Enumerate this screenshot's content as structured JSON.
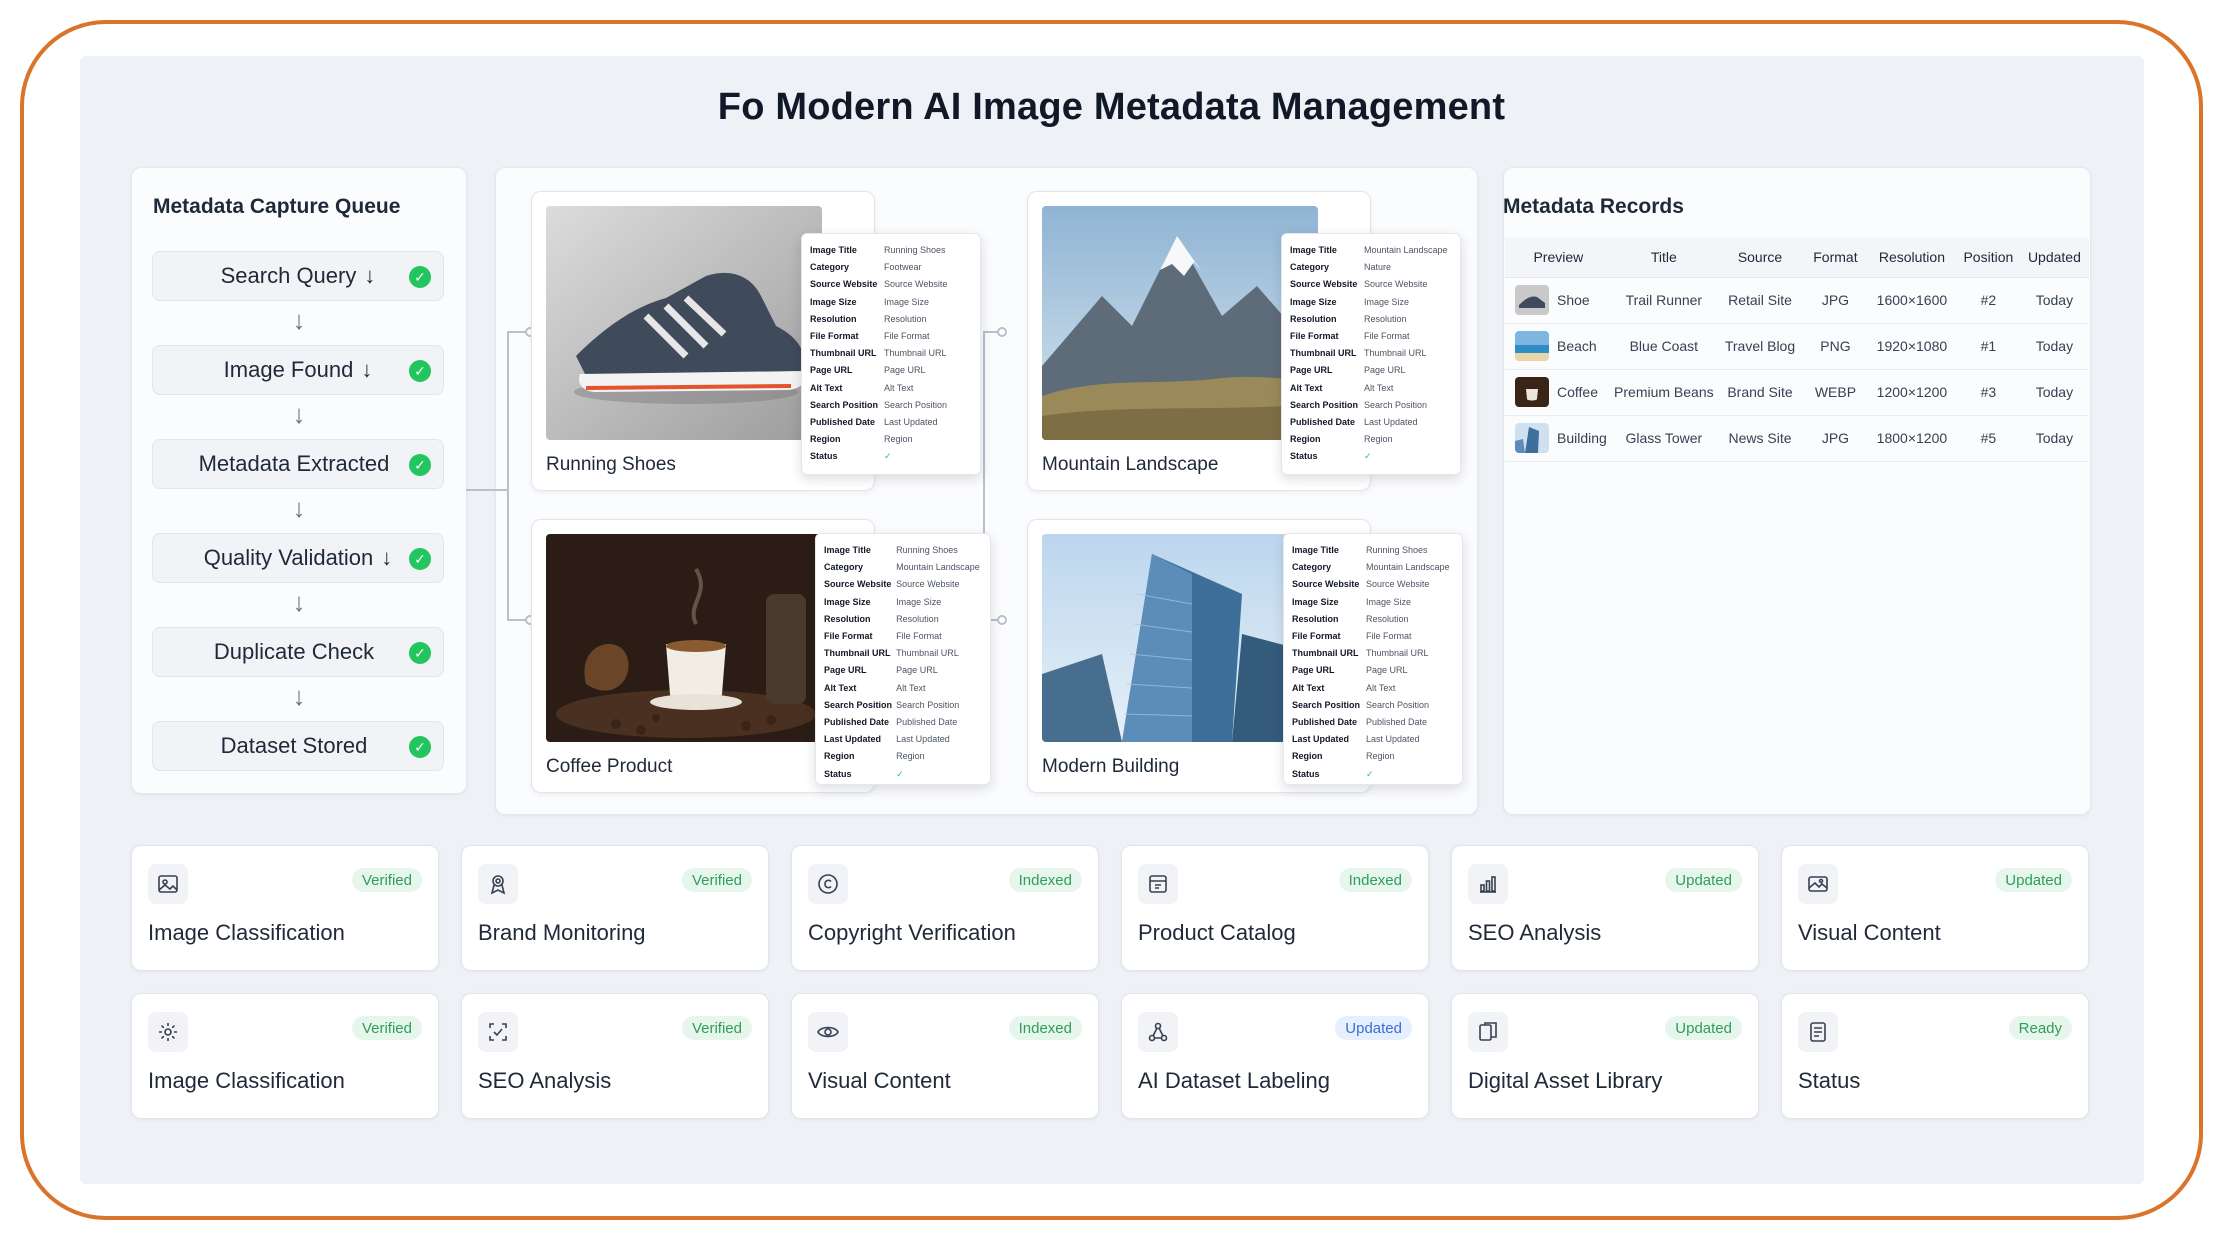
{
  "title": "Fo Modern AI Image Metadata Management",
  "colors": {
    "frame": "#d9742a",
    "check": "#22c55e",
    "badge_green": "#2f9e58",
    "badge_blue": "#3b6fd4"
  },
  "queue": {
    "title": "Metadata Capture Queue",
    "steps": [
      {
        "label": "Search Query",
        "arrow": "↓",
        "status_icon": "check-circle-icon"
      },
      {
        "label": "Image Found",
        "arrow": "↓",
        "status_icon": "check-circle-icon"
      },
      {
        "label": "Metadata Extracted",
        "arrow": "",
        "status_icon": "check-circle-icon"
      },
      {
        "label": "Quality Validation",
        "arrow": "↓",
        "status_icon": "check-circle-icon"
      },
      {
        "label": "Duplicate Check",
        "arrow": "",
        "status_icon": "check-circle-icon"
      },
      {
        "label": "Dataset Stored",
        "arrow": "",
        "status_icon": "check-circle-icon"
      }
    ],
    "connector_arrow": "↓",
    "check_glyph": "✓"
  },
  "images": [
    {
      "caption": "Running Shoes",
      "meta": [
        [
          "Image Title",
          "Running Shoes"
        ],
        [
          "Category",
          "Footwear"
        ],
        [
          "Source Website",
          "Source Website"
        ],
        [
          "Image Size",
          "Image Size"
        ],
        [
          "Resolution",
          "Resolution"
        ],
        [
          "File Format",
          "File Format"
        ],
        [
          "Thumbnail URL",
          "Thumbnail URL"
        ],
        [
          "Page URL",
          "Page URL"
        ],
        [
          "Alt Text",
          "Alt Text"
        ],
        [
          "Search Position",
          "Search Position"
        ],
        [
          "Published Date",
          "Last Updated"
        ],
        [
          "Region",
          "Region"
        ],
        [
          "Status",
          "✓"
        ]
      ]
    },
    {
      "caption": "Mountain Landscape",
      "meta": [
        [
          "Image Title",
          "Mountain Landscape"
        ],
        [
          "Category",
          "Nature"
        ],
        [
          "Source Website",
          "Source Website"
        ],
        [
          "Image Size",
          "Image Size"
        ],
        [
          "Resolution",
          "Resolution"
        ],
        [
          "File Format",
          "File Format"
        ],
        [
          "Thumbnail URL",
          "Thumbnail URL"
        ],
        [
          "Page URL",
          "Page URL"
        ],
        [
          "Alt Text",
          "Alt Text"
        ],
        [
          "Search Position",
          "Search Position"
        ],
        [
          "Published Date",
          "Last Updated"
        ],
        [
          "Region",
          "Region"
        ],
        [
          "Status",
          "✓"
        ]
      ]
    },
    {
      "caption": "Coffee Product",
      "meta": [
        [
          "Image Title",
          "Running Shoes"
        ],
        [
          "Category",
          "Mountain Landscape"
        ],
        [
          "Source Website",
          "Source Website"
        ],
        [
          "Image Size",
          "Image Size"
        ],
        [
          "Resolution",
          "Resolution"
        ],
        [
          "File Format",
          "File Format"
        ],
        [
          "Thumbnail URL",
          "Thumbnail URL"
        ],
        [
          "Page URL",
          "Page URL"
        ],
        [
          "Alt Text",
          "Alt Text"
        ],
        [
          "Search Position",
          "Search Position"
        ],
        [
          "Published Date",
          "Published Date"
        ],
        [
          "Last Updated",
          "Last Updated"
        ],
        [
          "Region",
          "Region"
        ],
        [
          "Status",
          "✓"
        ]
      ]
    },
    {
      "caption": "Modern Building",
      "meta": [
        [
          "Image Title",
          "Running Shoes"
        ],
        [
          "Category",
          "Mountain Landscape"
        ],
        [
          "Source Website",
          "Source Website"
        ],
        [
          "Image Size",
          "Image Size"
        ],
        [
          "Resolution",
          "Resolution"
        ],
        [
          "File Format",
          "File Format"
        ],
        [
          "Thumbnail URL",
          "Thumbnail URL"
        ],
        [
          "Page URL",
          "Page URL"
        ],
        [
          "Alt Text",
          "Alt Text"
        ],
        [
          "Search Position",
          "Search Position"
        ],
        [
          "Published Date",
          "Published Date"
        ],
        [
          "Last Updated",
          "Last Updated"
        ],
        [
          "Region",
          "Region"
        ],
        [
          "Status",
          "✓"
        ]
      ]
    }
  ],
  "records": {
    "title": "Metadata Records",
    "columns": [
      "Preview",
      "Title",
      "Source",
      "Format",
      "Resolution",
      "Position",
      "Updated"
    ],
    "rows": [
      {
        "preview": "Shoe",
        "title": "Trail Runner",
        "source": "Retail Site",
        "format": "JPG",
        "resolution": "1600×1600",
        "position": "#2",
        "updated": "Today"
      },
      {
        "preview": "Beach",
        "title": "Blue Coast",
        "source": "Travel Blog",
        "format": "PNG",
        "resolution": "1920×1080",
        "position": "#1",
        "updated": "Today"
      },
      {
        "preview": "Coffee",
        "title": "Premium Beans",
        "source": "Brand Site",
        "format": "WEBP",
        "resolution": "1200×1200",
        "position": "#3",
        "updated": "Today"
      },
      {
        "preview": "Building",
        "title": "Glass Tower",
        "source": "News Site",
        "format": "JPG",
        "resolution": "1800×1200",
        "position": "#5",
        "updated": "Today"
      }
    ]
  },
  "features": [
    {
      "label": "Image Classification",
      "badge": "Verified",
      "icon": "image-icon"
    },
    {
      "label": "Brand Monitoring",
      "badge": "Verified",
      "icon": "award-icon"
    },
    {
      "label": "Copyright Verification",
      "badge": "Indexed",
      "icon": "copyright-icon"
    },
    {
      "label": "Product Catalog",
      "badge": "Indexed",
      "icon": "catalog-icon"
    },
    {
      "label": "SEO Analysis",
      "badge": "Updated",
      "icon": "chart-icon"
    },
    {
      "label": "Visual Content",
      "badge": "Updated",
      "icon": "photo-icon"
    },
    {
      "label": "Image Classification",
      "badge": "Verified",
      "icon": "gear-icon"
    },
    {
      "label": "SEO Analysis",
      "badge": "Verified",
      "icon": "scan-icon"
    },
    {
      "label": "Visual Content",
      "badge": "Indexed",
      "icon": "eye-icon"
    },
    {
      "label": "AI Dataset Labeling",
      "badge": "Updated",
      "icon": "nodes-icon"
    },
    {
      "label": "Digital Asset Library",
      "badge": "Updated",
      "icon": "files-icon"
    },
    {
      "label": "Status",
      "badge": "Ready",
      "icon": "document-icon"
    }
  ]
}
